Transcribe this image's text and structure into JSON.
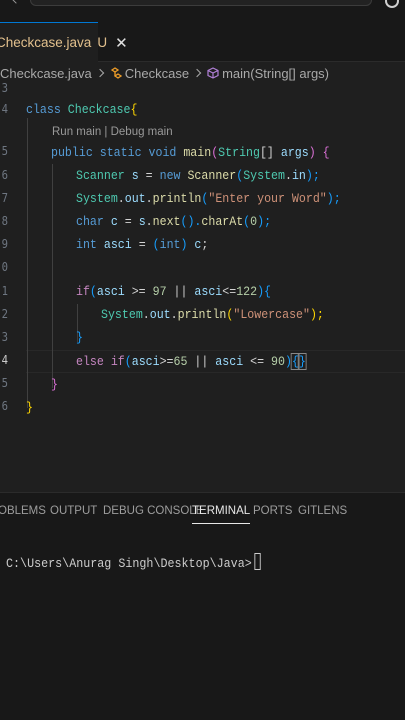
{
  "tab": {
    "filename": "Checkcase.java",
    "status": "U",
    "close": "✕"
  },
  "breadcrumb": {
    "file": "Checkcase.java",
    "class": "Checkcase",
    "method": "main(String[] args)"
  },
  "gutter": [
    "3",
    "4",
    "",
    "5",
    "6",
    "7",
    "8",
    "9",
    "0",
    "1",
    "2",
    "3",
    "4",
    "5",
    "6"
  ],
  "codelens": "Run main | Debug main",
  "code": {
    "l4": [
      "class",
      " ",
      "Checkcase",
      "{"
    ],
    "l5": [
      "public",
      " ",
      "static",
      " ",
      "void",
      " ",
      "main",
      "(",
      "String",
      "[] ",
      "args",
      ") ",
      "{"
    ],
    "l6": [
      "Scanner",
      " ",
      "s",
      " = ",
      "new",
      " ",
      "Scanner",
      "(",
      "System",
      ".",
      "in",
      ");"
    ],
    "l7": [
      "System",
      ".",
      "out",
      ".",
      "println",
      "(",
      "\"Enter your Word\"",
      ");"
    ],
    "l8": [
      "char",
      " ",
      "c",
      " = ",
      "s",
      ".",
      "next",
      "().",
      "charAt",
      "(",
      "0",
      ");"
    ],
    "l9": [
      "int",
      " ",
      "asci",
      " = ",
      "(",
      "int",
      ") ",
      "c",
      ";"
    ],
    "l11": [
      "if",
      "(",
      "asci",
      " >= ",
      "97",
      " || ",
      "asci",
      "<=",
      "122",
      ")",
      "{"
    ],
    "l12": [
      "System",
      ".",
      "out",
      ".",
      "println",
      "(",
      "\"Lowercase\"",
      ");"
    ],
    "l13": [
      "}"
    ],
    "l14": [
      "else",
      " ",
      "if",
      "(",
      "asci",
      ">=",
      "65",
      " || ",
      "asci",
      " <= ",
      "90",
      ")",
      "{",
      "}"
    ],
    "l15": [
      "}"
    ],
    "l16": [
      "}"
    ]
  },
  "panel": {
    "tabs": [
      "OBLEMS",
      "OUTPUT",
      "DEBUG CONSOLE",
      "TERMINAL",
      "PORTS",
      "GITLENS"
    ],
    "active_tab": "TERMINAL",
    "prompt": "C:\\Users\\Anurag Singh\\Desktop\\Java>"
  }
}
